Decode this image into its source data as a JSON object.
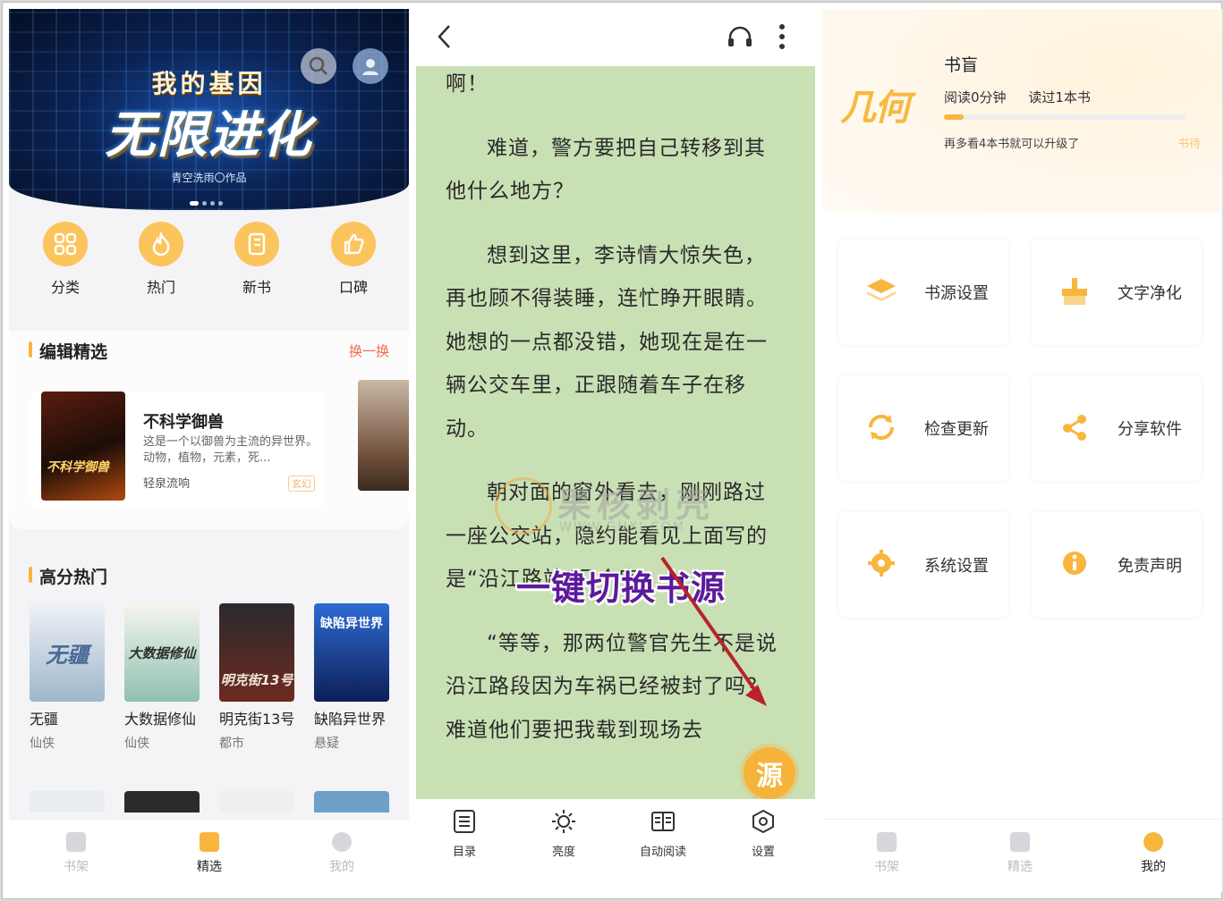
{
  "panel_discover": {
    "banner": {
      "line1": "我的基因",
      "line2": "无限进化",
      "author": "青空洗雨〇作品"
    },
    "quick": [
      {
        "label": "分类",
        "icon": "grid-icon"
      },
      {
        "label": "热门",
        "icon": "flame-icon"
      },
      {
        "label": "新书",
        "icon": "book-icon"
      },
      {
        "label": "口碑",
        "icon": "thumbs-up-icon"
      }
    ],
    "editor_pick": {
      "title": "编辑精选",
      "swap": "换一换",
      "book": {
        "cover_text": "不科学御兽",
        "title": "不科学御兽",
        "desc": "这是一个以御兽为主流的异世界。动物，植物，元素，死...",
        "author": "轻泉流响",
        "tag": "玄幻"
      }
    },
    "hot": {
      "title": "高分热门",
      "books": [
        {
          "title": "无疆",
          "cat": "仙侠",
          "cover_text": "无疆",
          "color1": "#e9eef3",
          "color2": "#9bb4cc"
        },
        {
          "title": "大数据修仙",
          "cat": "仙侠",
          "cover_text": "大数据修仙",
          "color1": "#f2f2ea",
          "color2": "#8fc0b0"
        },
        {
          "title": "明克街13号",
          "cat": "都市",
          "cover_text": "明克街13号",
          "color1": "#2a2a2e",
          "color2": "#6e2a1e"
        },
        {
          "title": "缺陷异世界",
          "cat": "悬疑",
          "cover_text": "缺陷异世界",
          "color1": "#2d6bd4",
          "color2": "#0d1f56"
        }
      ]
    },
    "tabs": [
      {
        "label": "书架",
        "active": false
      },
      {
        "label": "精选",
        "active": true
      },
      {
        "label": "我的",
        "active": false
      }
    ]
  },
  "panel_reader": {
    "paragraphs": [
      "啊！",
      "难道，警方要把自己转移到其他什么地方？",
      "想到这里，李诗情大惊失色，再也顾不得装睡，连忙睁开眼睛。她想的一点都没错，她现在是在一辆公交车里，正跟随着车子在移动。",
      "朝对面的窗外看去，刚刚路过一座公交站，隐约能看见上面写的是“沿江路站”几个字。",
      "“等等，那两位警官先生不是说沿江路段因为车祸已经被封了吗？难道他们要把我载到现场去"
    ],
    "watermark": {
      "text": "果核剥壳",
      "url": "WWW.GHXI.COM"
    },
    "callout": "一键切换书源",
    "source_button": "源",
    "bottom": [
      {
        "label": "目录",
        "icon": "list-icon"
      },
      {
        "label": "亮度",
        "icon": "sun-icon"
      },
      {
        "label": "自动阅读",
        "icon": "book-open-icon"
      },
      {
        "label": "设置",
        "icon": "gear-icon"
      }
    ]
  },
  "panel_mine": {
    "logo": "几何",
    "level": "书盲",
    "read_time": "阅读0分钟",
    "read_books": "读过1本书",
    "progress": 0.08,
    "hint": "再多看4本书就可以升级了",
    "level_link": "书待",
    "tiles": [
      {
        "label": "书源设置",
        "icon": "layers-icon"
      },
      {
        "label": "文字净化",
        "icon": "brush-icon"
      },
      {
        "label": "检查更新",
        "icon": "refresh-icon"
      },
      {
        "label": "分享软件",
        "icon": "share-icon"
      },
      {
        "label": "系统设置",
        "icon": "gear-icon"
      },
      {
        "label": "免责声明",
        "icon": "info-icon"
      }
    ],
    "tabs": [
      {
        "label": "书架",
        "active": false
      },
      {
        "label": "精选",
        "active": false
      },
      {
        "label": "我的",
        "active": true
      }
    ]
  }
}
